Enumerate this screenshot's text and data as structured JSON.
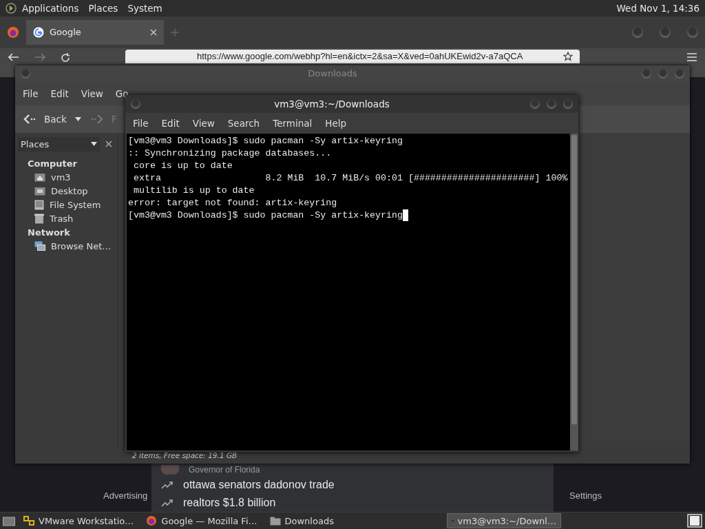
{
  "top_panel": {
    "menus": [
      "Applications",
      "Places",
      "System"
    ],
    "clock": "Wed Nov 1, 14:36"
  },
  "browser": {
    "tabs": [
      {
        "label": "Google",
        "selected": true
      }
    ],
    "url": "https://www.google.com/webhp?hl=en&ictx=2&sa=X&ved=0ahUKEwid2v-a7aQCA",
    "suggestions": [
      {
        "kind": "person",
        "text": "Governor of Florida"
      },
      {
        "kind": "trend",
        "text": "ottawa senators dadonov trade"
      },
      {
        "kind": "trend",
        "text": "realtors $1.8 billion"
      }
    ],
    "footer_links": [
      "Advertising",
      "Settings"
    ]
  },
  "file_manager": {
    "title": "Downloads",
    "menu": [
      "File",
      "Edit",
      "View",
      "Go"
    ],
    "back": "Back",
    "forward": "F",
    "sidebar": {
      "selector": "Places",
      "sections": [
        {
          "heading": "Computer",
          "items": [
            {
              "label": "vm3",
              "kind": "home"
            },
            {
              "label": "Desktop",
              "kind": "desktop"
            },
            {
              "label": "File System",
              "kind": "drive"
            },
            {
              "label": "Trash",
              "kind": "trash"
            }
          ]
        },
        {
          "heading": "Network",
          "items": [
            {
              "label": "Browse Net…",
              "kind": "network"
            }
          ]
        }
      ]
    },
    "status": "2 items, Free space: 19.1 GB"
  },
  "terminal": {
    "title": "vm3@vm3:~/Downloads",
    "menu": [
      "File",
      "Edit",
      "View",
      "Search",
      "Terminal",
      "Help"
    ],
    "lines": [
      "[vm3@vm3 Downloads]$ sudo pacman -Sy artix-keyring",
      ":: Synchronizing package databases...",
      " core is up to date",
      " extra                   8.2 MiB  10.7 MiB/s 00:01 [######################] 100%",
      " multilib is up to date",
      "error: target not found: artix-keyring",
      "[vm3@vm3 Downloads]$ sudo pacman -Sy artix-keyring"
    ]
  },
  "taskbar": {
    "items": [
      {
        "kind": "vmware",
        "label": "VMware Workstatio…",
        "selected": false
      },
      {
        "kind": "firefox",
        "label": "Google — Mozilla Fi…",
        "selected": false
      },
      {
        "kind": "folder",
        "label": "Downloads",
        "selected": false
      },
      {
        "kind": "terminal",
        "label": "vm3@vm3:~/Downl…",
        "selected": true
      }
    ]
  }
}
